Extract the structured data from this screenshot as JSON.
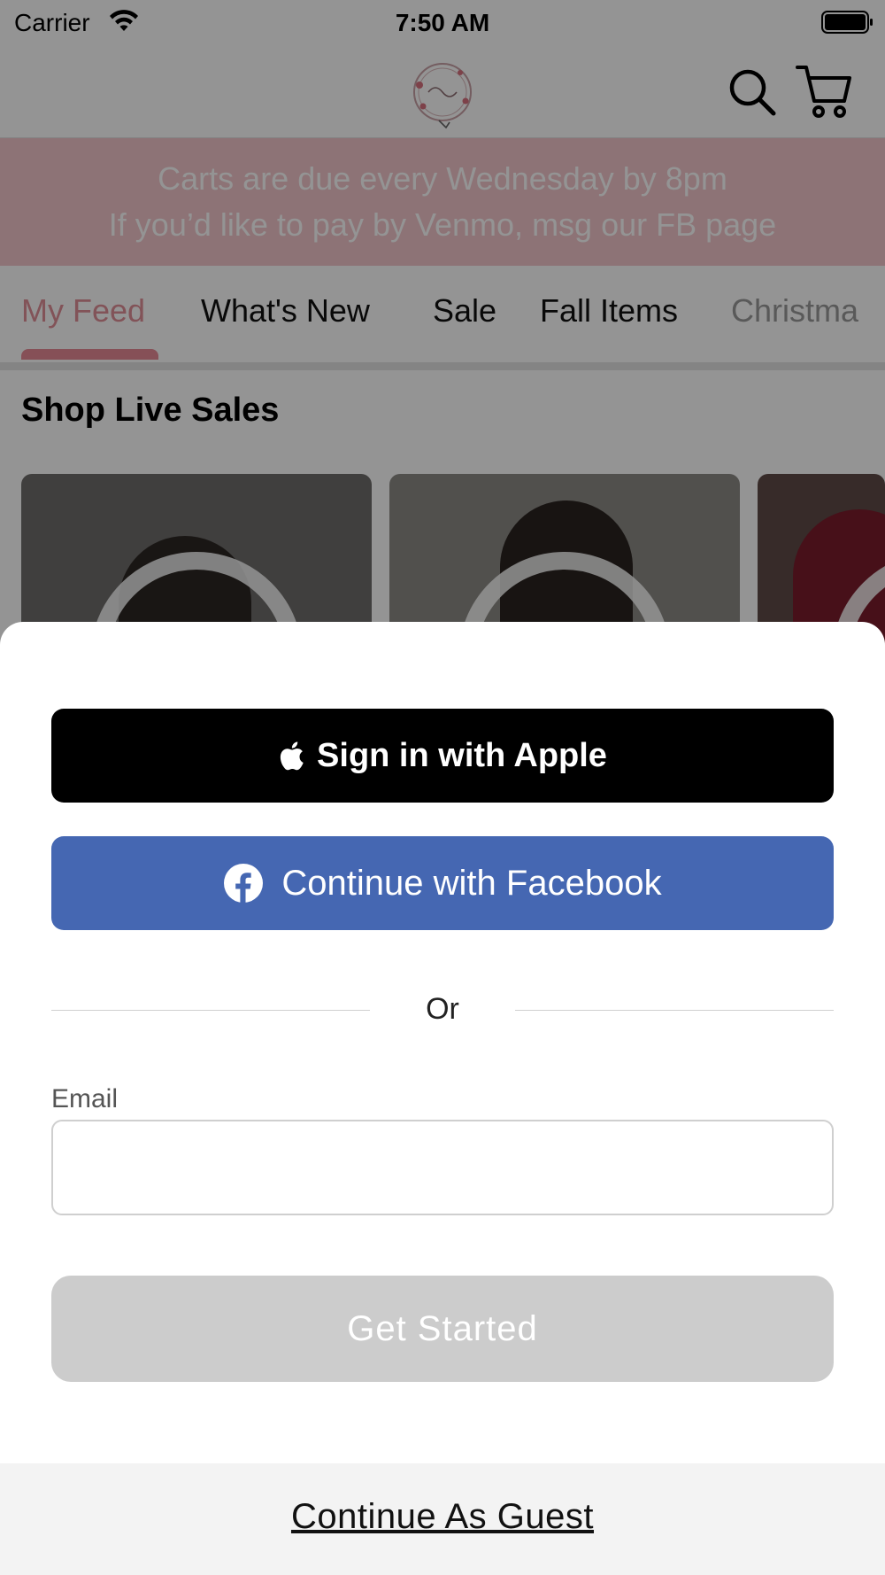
{
  "status_bar": {
    "carrier": "Carrier",
    "time": "7:50 AM",
    "wifi_icon": "wifi-icon",
    "battery_icon": "battery-icon"
  },
  "header": {
    "logo_icon": "store-logo",
    "search_icon": "search-icon",
    "cart_icon": "cart-icon"
  },
  "banner": {
    "line1": "Carts are due every Wednesday by 8pm",
    "line2": "If you’d like to pay by Venmo, msg our FB page",
    "background": "#f3c6cb"
  },
  "tabs": [
    {
      "label": "My Feed",
      "active": true
    },
    {
      "label": "What's New",
      "active": false
    },
    {
      "label": "Sale",
      "active": false
    },
    {
      "label": "Fall Items",
      "active": false
    },
    {
      "label": "Christma",
      "active": false
    }
  ],
  "section": {
    "title": "Shop Live Sales"
  },
  "sheet": {
    "apple_button": "Sign in with Apple",
    "facebook_button": "Continue with Facebook",
    "or_label": "Or",
    "email_label": "Email",
    "email_value": "",
    "get_started": "Get Started",
    "guest_link": "Continue As Guest"
  },
  "colors": {
    "accent_pink": "#e78a96",
    "facebook_blue": "#4567b2",
    "disabled_gray": "#cccccc"
  }
}
